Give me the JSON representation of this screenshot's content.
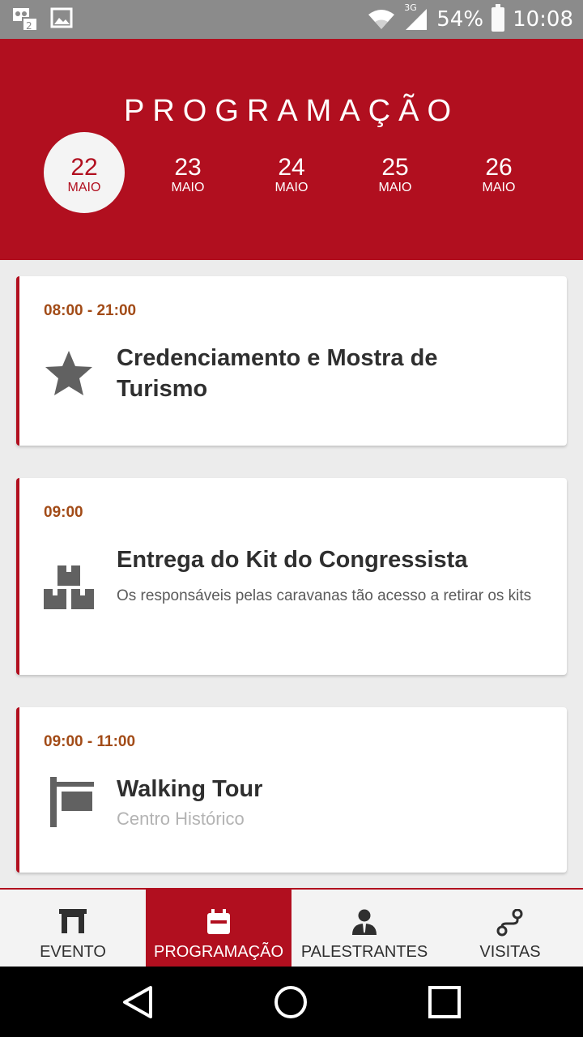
{
  "status": {
    "network": "3G",
    "battery": "54%",
    "time": "10:08"
  },
  "header": {
    "title": "PROGRAMAÇÃO",
    "dates": [
      {
        "day": "22",
        "month": "MAIO",
        "selected": true
      },
      {
        "day": "23",
        "month": "MAIO",
        "selected": false
      },
      {
        "day": "24",
        "month": "MAIO",
        "selected": false
      },
      {
        "day": "25",
        "month": "MAIO",
        "selected": false
      },
      {
        "day": "26",
        "month": "MAIO",
        "selected": false
      }
    ]
  },
  "events": [
    {
      "time": "08:00 - 21:00",
      "icon": "star-icon",
      "title": "Credenciamento e Mostra de Turismo"
    },
    {
      "time": "09:00",
      "icon": "boxes-icon",
      "title": "Entrega do Kit do Congressista",
      "description": "Os responsáveis pelas caravanas tão acesso a retirar os kits"
    },
    {
      "time": "09:00 - 11:00",
      "icon": "signpost-icon",
      "title": "Walking Tour",
      "subtitle": "Centro Histórico"
    }
  ],
  "bottom_nav": [
    {
      "label": "EVENTO",
      "icon": "building-icon",
      "active": false
    },
    {
      "label": "PROGRAMAÇÃO",
      "icon": "calendar-icon",
      "active": true
    },
    {
      "label": "PALESTRANTES",
      "icon": "speaker-icon",
      "active": false
    },
    {
      "label": "VISITAS",
      "icon": "route-icon",
      "active": false
    }
  ],
  "colors": {
    "primary": "#b10f1f",
    "time_text": "#a24b17",
    "background": "#ececec"
  }
}
